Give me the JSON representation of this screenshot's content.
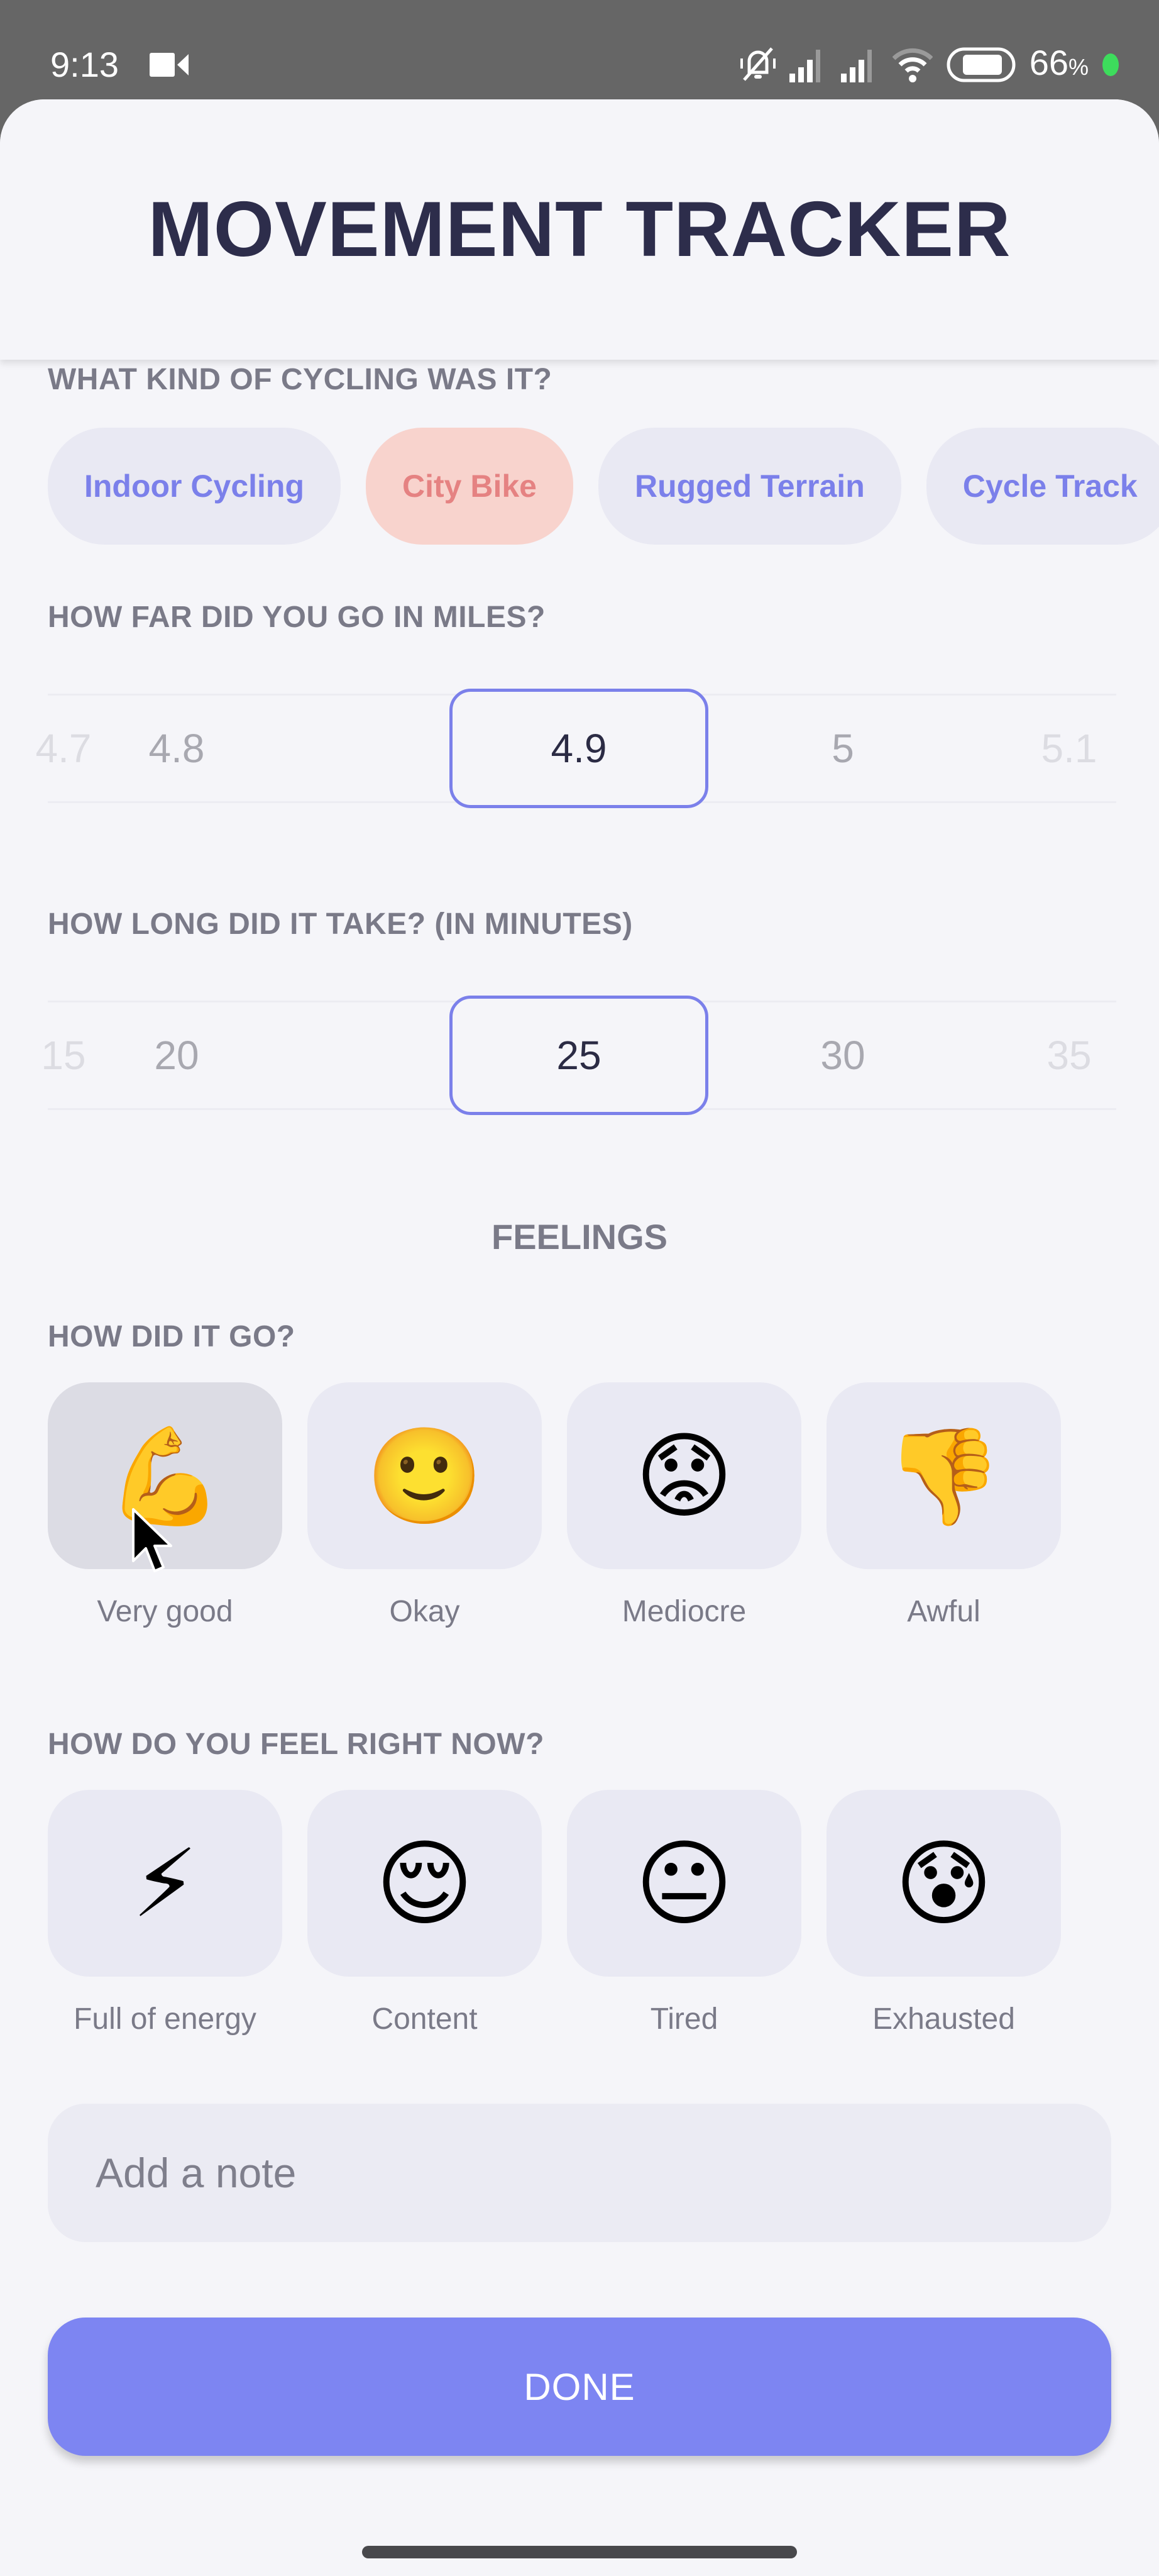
{
  "status_bar": {
    "time": "9:13",
    "battery_percent": "66",
    "battery_suffix": "%",
    "icons": [
      "video-record-icon",
      "bell-muted-icon",
      "signal-icon",
      "signal-icon",
      "wifi-icon",
      "battery-icon",
      "privacy-dot-icon"
    ]
  },
  "header": {
    "title": "MOVEMENT TRACKER"
  },
  "cycling_type": {
    "label": "WHAT KIND OF CYCLING WAS IT?",
    "options": [
      {
        "label": "Indoor Cycling",
        "selected": false
      },
      {
        "label": "City Bike",
        "selected": true
      },
      {
        "label": "Rugged Terrain",
        "selected": false
      },
      {
        "label": "Cycle Track",
        "selected": false
      }
    ],
    "colors": {
      "chip_bg": "#e9e9f3",
      "chip_text": "#7b80ea",
      "selected_bg": "#f8d3cd",
      "selected_text": "#e58282"
    }
  },
  "distance": {
    "label": "HOW FAR DID YOU GO IN MILES?",
    "values": [
      "4.7",
      "4.8",
      "4.9",
      "5",
      "5.1"
    ],
    "selected": "4.9"
  },
  "duration": {
    "label": "HOW LONG DID IT TAKE? (IN MINUTES)",
    "values": [
      "15",
      "20",
      "25",
      "30",
      "35"
    ],
    "selected": "25"
  },
  "feelings": {
    "title": "FEELINGS",
    "how_did_it_go": {
      "label": "HOW DID IT GO?",
      "options": [
        {
          "emoji": "💪",
          "icon": "flexed-biceps-icon",
          "label": "Very good",
          "selected": true
        },
        {
          "emoji": "🙂",
          "icon": "slightly-smiling-face-icon",
          "label": "Okay",
          "selected": false
        },
        {
          "emoji": "😟",
          "icon": "worried-face-icon",
          "label": "Mediocre",
          "selected": false
        },
        {
          "emoji": "👎",
          "icon": "thumbs-down-icon",
          "label": "Awful",
          "selected": false
        }
      ]
    },
    "feel_now": {
      "label": "HOW DO YOU FEEL RIGHT NOW?",
      "options": [
        {
          "emoji": "⚡",
          "icon": "lightning-icon",
          "label": "Full of energy",
          "selected": false
        },
        {
          "emoji": "😌",
          "icon": "relieved-face-icon",
          "label": "Content",
          "selected": false
        },
        {
          "emoji": "😐",
          "icon": "neutral-face-icon",
          "label": "Tired",
          "selected": false
        },
        {
          "emoji": "😰",
          "icon": "anxious-sweat-face-icon",
          "label": "Exhausted",
          "selected": false
        }
      ]
    }
  },
  "note": {
    "placeholder": "Add a note",
    "value": ""
  },
  "done_button": {
    "label": "DONE",
    "color": "#7d85f2"
  },
  "accent_color": "#7b80ea"
}
